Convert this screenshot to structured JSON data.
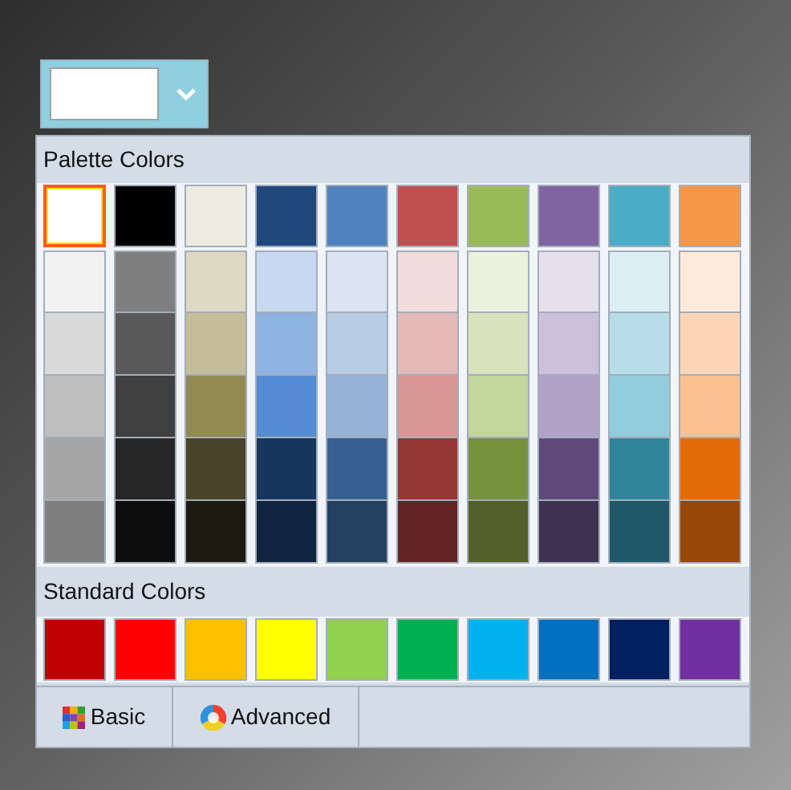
{
  "color_button": {
    "color": "#ffffff"
  },
  "palette": {
    "title": "Palette Colors",
    "columns": [
      {
        "swatches": [
          {
            "color": "#ffffff",
            "selected": true
          },
          {
            "color": "#f2f2f2",
            "selected": false
          },
          {
            "color": "#d9d9d9",
            "selected": false
          },
          {
            "color": "#bfbfbf",
            "selected": false
          },
          {
            "color": "#a6a6a6",
            "selected": false
          },
          {
            "color": "#7f7f7f",
            "selected": false
          }
        ]
      },
      {
        "swatches": [
          {
            "color": "#000000",
            "selected": false
          },
          {
            "color": "#7f7f7f",
            "selected": false
          },
          {
            "color": "#595959",
            "selected": false
          },
          {
            "color": "#404040",
            "selected": false
          },
          {
            "color": "#262626",
            "selected": false
          },
          {
            "color": "#0d0d0d",
            "selected": false
          }
        ]
      },
      {
        "swatches": [
          {
            "color": "#eeece1",
            "selected": false
          },
          {
            "color": "#ddd9c3",
            "selected": false
          },
          {
            "color": "#c4bd97",
            "selected": false
          },
          {
            "color": "#938953",
            "selected": false
          },
          {
            "color": "#494429",
            "selected": false
          },
          {
            "color": "#1d1b10",
            "selected": false
          }
        ]
      },
      {
        "swatches": [
          {
            "color": "#1f497d",
            "selected": false
          },
          {
            "color": "#c6d9f0",
            "selected": false
          },
          {
            "color": "#8db3e2",
            "selected": false
          },
          {
            "color": "#548dd4",
            "selected": false
          },
          {
            "color": "#17365d",
            "selected": false
          },
          {
            "color": "#0f243e",
            "selected": false
          }
        ]
      },
      {
        "swatches": [
          {
            "color": "#4f81bd",
            "selected": false
          },
          {
            "color": "#dbe5f1",
            "selected": false
          },
          {
            "color": "#b8cce4",
            "selected": false
          },
          {
            "color": "#95b3d7",
            "selected": false
          },
          {
            "color": "#366092",
            "selected": false
          },
          {
            "color": "#244061",
            "selected": false
          }
        ]
      },
      {
        "swatches": [
          {
            "color": "#c0504d",
            "selected": false
          },
          {
            "color": "#f2dcdb",
            "selected": false
          },
          {
            "color": "#e5b9b7",
            "selected": false
          },
          {
            "color": "#d99694",
            "selected": false
          },
          {
            "color": "#953734",
            "selected": false
          },
          {
            "color": "#632423",
            "selected": false
          }
        ]
      },
      {
        "swatches": [
          {
            "color": "#9bbb59",
            "selected": false
          },
          {
            "color": "#ebf1dd",
            "selected": false
          },
          {
            "color": "#d7e3bc",
            "selected": false
          },
          {
            "color": "#c3d69b",
            "selected": false
          },
          {
            "color": "#76923c",
            "selected": false
          },
          {
            "color": "#4f6128",
            "selected": false
          }
        ]
      },
      {
        "swatches": [
          {
            "color": "#8064a2",
            "selected": false
          },
          {
            "color": "#e5e0ec",
            "selected": false
          },
          {
            "color": "#ccc1d9",
            "selected": false
          },
          {
            "color": "#b2a2c7",
            "selected": false
          },
          {
            "color": "#5f497a",
            "selected": false
          },
          {
            "color": "#3f3151",
            "selected": false
          }
        ]
      },
      {
        "swatches": [
          {
            "color": "#4bacc6",
            "selected": false
          },
          {
            "color": "#dbeef3",
            "selected": false
          },
          {
            "color": "#b7dde8",
            "selected": false
          },
          {
            "color": "#92cddc",
            "selected": false
          },
          {
            "color": "#31859b",
            "selected": false
          },
          {
            "color": "#205867",
            "selected": false
          }
        ]
      },
      {
        "swatches": [
          {
            "color": "#f79646",
            "selected": false
          },
          {
            "color": "#fdeada",
            "selected": false
          },
          {
            "color": "#fbd5b5",
            "selected": false
          },
          {
            "color": "#fac08f",
            "selected": false
          },
          {
            "color": "#e36c09",
            "selected": false
          },
          {
            "color": "#974806",
            "selected": false
          }
        ]
      }
    ]
  },
  "standard": {
    "title": "Standard Colors",
    "swatches": [
      {
        "color": "#c00000",
        "selected": false
      },
      {
        "color": "#ff0000",
        "selected": false
      },
      {
        "color": "#ffc000",
        "selected": false
      },
      {
        "color": "#ffff00",
        "selected": false
      },
      {
        "color": "#92d050",
        "selected": false
      },
      {
        "color": "#00b050",
        "selected": false
      },
      {
        "color": "#00b0f0",
        "selected": false
      },
      {
        "color": "#0070c0",
        "selected": false
      },
      {
        "color": "#002060",
        "selected": false
      },
      {
        "color": "#7030a0",
        "selected": false
      }
    ]
  },
  "tabs": [
    {
      "label": "Basic",
      "kind": "basic"
    },
    {
      "label": "Advanced",
      "kind": "advanced"
    }
  ]
}
